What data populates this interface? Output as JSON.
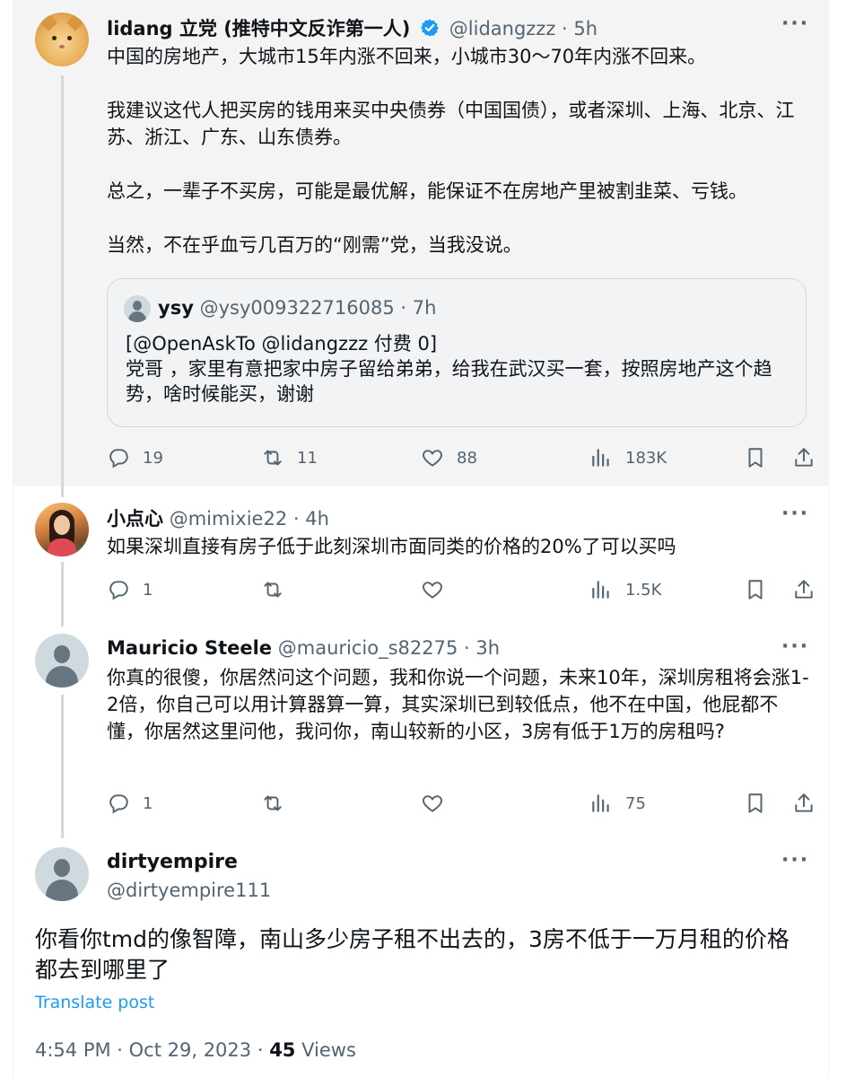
{
  "main_post": {
    "name": "lidang 立党 (推特中文反诈第一人)",
    "handle": "@lidangzzz",
    "time": "5h",
    "paragraphs": [
      "中国的房地产，大城市15年内涨不回来，小城市30～70年内涨不回来。",
      "我建议这代人把买房的钱用来买中央债券（中国国债），或者深圳、上海、北京、江苏、浙江、广东、山东债券。",
      "总之，一辈子不买房，可能是最优解，能保证不在房地产里被割韭菜、亏钱。",
      "当然，不在乎血亏几百万的“刚需”党，当我没说。"
    ],
    "quote": {
      "name": "ysy",
      "handle": "@ysy009322716085",
      "time": "7h",
      "line1": "[@OpenAskTo @lidangzzz  付费 0]",
      "line2": "党哥 ，家里有意把家中房子留给弟弟，给我在武汉买一套，按照房地产这个趋势，啥时候能买，谢谢"
    },
    "replies": "19",
    "reposts": "11",
    "likes": "88",
    "views": "183K"
  },
  "reply1": {
    "name": "小点心",
    "handle": "@mimixie22",
    "time": "4h",
    "text": "如果深圳直接有房子低于此刻深圳市面同类的价格的20%了可以买吗",
    "replies": "1",
    "views": "1.5K"
  },
  "reply2": {
    "name": "Mauricio Steele",
    "handle": "@mauricio_s82275",
    "time": "3h",
    "text": "你真的很傻，你居然问这个问题，我和你说一个问题，未来10年，深圳房租将会涨1-2倍，你自己可以用计算器算一算，其实深圳已到较低点，他不在中国，他屁都不懂，你居然这里问他，我问你，南山较新的小区，3房有低于1万的房租吗?",
    "replies": "1",
    "views": "75"
  },
  "focus_post": {
    "name": "dirtyempire",
    "handle": "@dirtyempire111",
    "text": "你看你tmd的像智障，南山多少房子租不出去的，3房不低于一万月租的价格都去到哪里了",
    "translate": "Translate post",
    "time": "4:54 PM · Oct 29, 2023",
    "views_count": "45",
    "views_label": "Views"
  },
  "ui": {
    "sep": " · ",
    "more": "···"
  },
  "colors": {
    "accent": "#1d9bf0",
    "muted": "#536471",
    "text": "#0f1419"
  }
}
